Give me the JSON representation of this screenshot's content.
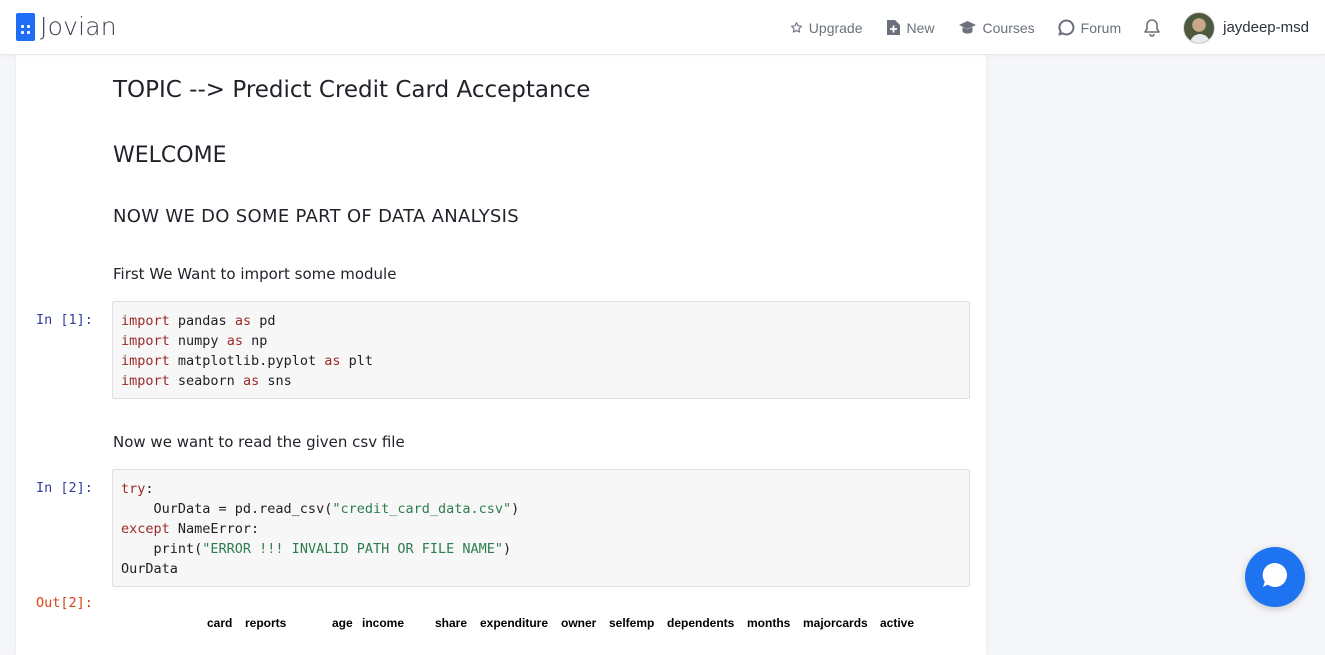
{
  "brand": {
    "name": "Jovian"
  },
  "nav": {
    "upgrade": "Upgrade",
    "new": "New",
    "courses": "Courses",
    "forum": "Forum",
    "username": "jaydeep-msd"
  },
  "notebook": {
    "topic": "TOPIC --> Predict Credit Card Acceptance",
    "welcome": "WELCOME",
    "section": "NOW WE DO SOME PART OF DATA ANALYSIS",
    "text1": "First We Want to import some module",
    "text2": "Now we want to read the given csv file",
    "cell1": {
      "prompt": "In [1]:",
      "lines": [
        [
          "import",
          " pandas ",
          "as",
          " pd"
        ],
        [
          "import",
          " numpy ",
          "as",
          " np"
        ],
        [
          "import",
          " matplotlib.pyplot ",
          "as",
          " plt"
        ],
        [
          "import",
          " seaborn ",
          "as",
          " sns"
        ]
      ]
    },
    "cell2": {
      "prompt": "In [2]:",
      "line1_kw": "try",
      "line1_rest": ":",
      "line2_pre": "    OurData = pd.read_csv(",
      "line2_str": "\"credit_card_data.csv\"",
      "line2_post": ")",
      "line3_kw": "except",
      "line3_rest": " NameError:",
      "line4_pre": "    print(",
      "line4_str": "\"ERROR !!! INVALID PATH OR FILE NAME\"",
      "line4_post": ")",
      "line5": "OurData"
    },
    "output_prompt": "Out[2]:",
    "dataframe_columns": [
      "card",
      "reports",
      "age",
      "income",
      "share",
      "expenditure",
      "owner",
      "selfemp",
      "dependents",
      "months",
      "majorcards",
      "active"
    ]
  },
  "colors": {
    "brand_blue": "#1f6cf6",
    "chat_blue": "#1e74f0",
    "in_prompt": "#303f9f",
    "out_prompt": "#d84315"
  }
}
